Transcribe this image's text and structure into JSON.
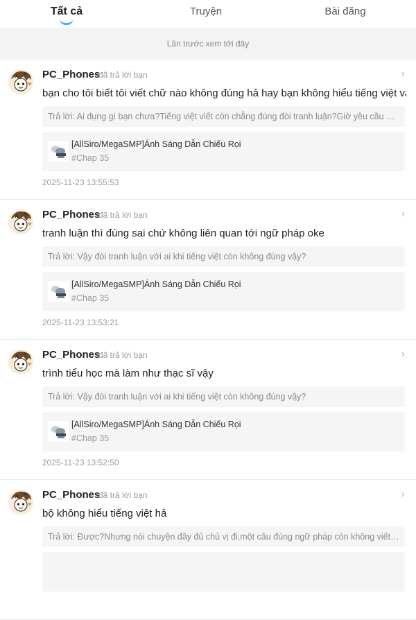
{
  "tabs": [
    {
      "label": "Tất cả",
      "active": true
    },
    {
      "label": "Truyện",
      "active": false
    },
    {
      "label": "Bài đăng",
      "active": false
    }
  ],
  "last_seen_label": "Lần trước xem tới đây",
  "colors": {
    "accent": "#4aa8ff",
    "bg_gray": "#f3f3f3"
  },
  "items": [
    {
      "username": "PC_Phones",
      "action": "đã trả lời bạn",
      "message": "bạn cho tôi biết tôi viết chữ nào không đúng hả hay bạn không hiểu tiếng việt vậy",
      "quote": "Trả lời: Ai đụng gì bạn chưa?Tiếng việt viết còn chẳng đúng đòi tranh luận?Giờ yêu cầu bạn viết lại cho đúng",
      "ref_title": "[AllSiro/MegaSMP]Ánh Sáng Dẫn Chiếu Rọi",
      "ref_sub": "#Chap 35",
      "time": "2025-11-23 13:55:53"
    },
    {
      "username": "PC_Phones",
      "action": "đã trả lời bạn",
      "message": "tranh luận thì đúng sai chứ không liên quan tới ngữ pháp oke",
      "quote": "Trả lời: Vậy đòi tranh luận với ai khi tiếng việt còn không đúng vậy?",
      "ref_title": "[AllSiro/MegaSMP]Ánh Sáng Dẫn Chiếu Rọi",
      "ref_sub": "#Chap 35",
      "time": "2025-11-23 13:53:21"
    },
    {
      "username": "PC_Phones",
      "action": "đã trả lời bạn",
      "message": "trình tiểu học mà làm như thạc sĩ vậy",
      "quote": "Trả lời: Vậy đòi tranh luận với ai khi tiếng việt còn không đúng vậy?",
      "ref_title": "[AllSiro/MegaSMP]Ánh Sáng Dẫn Chiếu Rọi",
      "ref_sub": "#Chap 35",
      "time": "2025-11-23 13:52:50"
    },
    {
      "username": "PC_Phones",
      "action": "đã trả lời bạn",
      "message": "bộ không hiểu tiếng việt hả",
      "quote": "Trả lời: Được?Nhưng nói chuyện đầy đủ chủ vị đi,một câu đúng ngữ pháp còn không viết nổi thì tranh luận gì",
      "ref_title": "",
      "ref_sub": "",
      "time": ""
    }
  ]
}
